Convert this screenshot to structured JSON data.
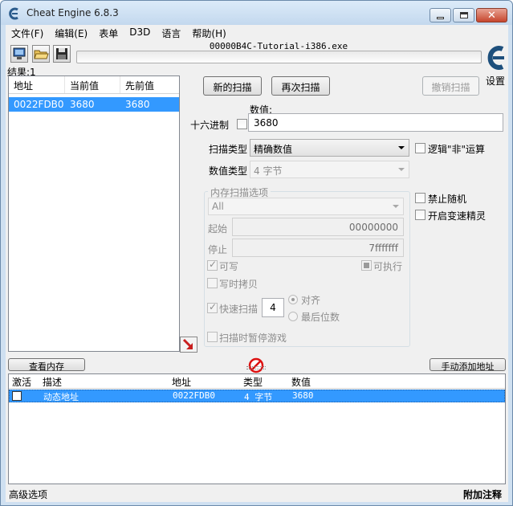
{
  "window": {
    "title": "Cheat Engine 6.8.3"
  },
  "menu": [
    {
      "label": "文件(F)"
    },
    {
      "label": "编辑(E)"
    },
    {
      "label": "表单"
    },
    {
      "label": "D3D"
    },
    {
      "label": "语言"
    },
    {
      "label": "帮助(H)"
    }
  ],
  "toolbar": {
    "process_name": "00000B4C-Tutorial-i386.exe",
    "settings_label": "设置"
  },
  "results": {
    "count_label": "结果:1",
    "columns": [
      "地址",
      "当前值",
      "先前值"
    ],
    "rows": [
      {
        "address": "0022FDB0",
        "current": "3680",
        "previous": "3680"
      }
    ]
  },
  "scan": {
    "new_scan_label": "新的扫描",
    "next_scan_label": "再次扫描",
    "undo_scan_label": "撤销扫描",
    "value_label": "数值:",
    "hex_label": "十六进制",
    "value_input": "3680",
    "scan_type_label": "扫描类型",
    "scan_type_value": "精确数值",
    "value_type_label": "数值类型",
    "value_type_value": "4 字节",
    "not_logic_label": "逻辑\"非\"运算",
    "disable_random_label": "禁止随机",
    "speedhack_label": "开启变速精灵"
  },
  "memory_options": {
    "title": "内存扫描选项",
    "region_value": "All",
    "start_label": "起始",
    "start_value": "00000000",
    "stop_label": "停止",
    "stop_value": "7fffffff",
    "writable_label": "可写",
    "executable_label": "可执行",
    "copy_on_write_label": "写时拷贝",
    "fast_scan_label": "快速扫描",
    "fast_scan_value": "4",
    "align_label": "对齐",
    "last_digits_label": "最后位数",
    "pause_game_label": "扫描时暂停游戏"
  },
  "bottom": {
    "view_memory_label": "查看内存",
    "add_address_label": "手动添加地址"
  },
  "address_list": {
    "columns": [
      "激活",
      "描述",
      "地址",
      "类型",
      "数值"
    ],
    "rows": [
      {
        "description": "动态地址",
        "address": "0022FDB0",
        "type": "4 字节",
        "value": "3680"
      }
    ]
  },
  "status": {
    "advanced_options": "高级选项",
    "table_extras": "附加注释"
  },
  "colors": {
    "selection": "#3399ff",
    "title_bar": "#cfe0f1"
  }
}
